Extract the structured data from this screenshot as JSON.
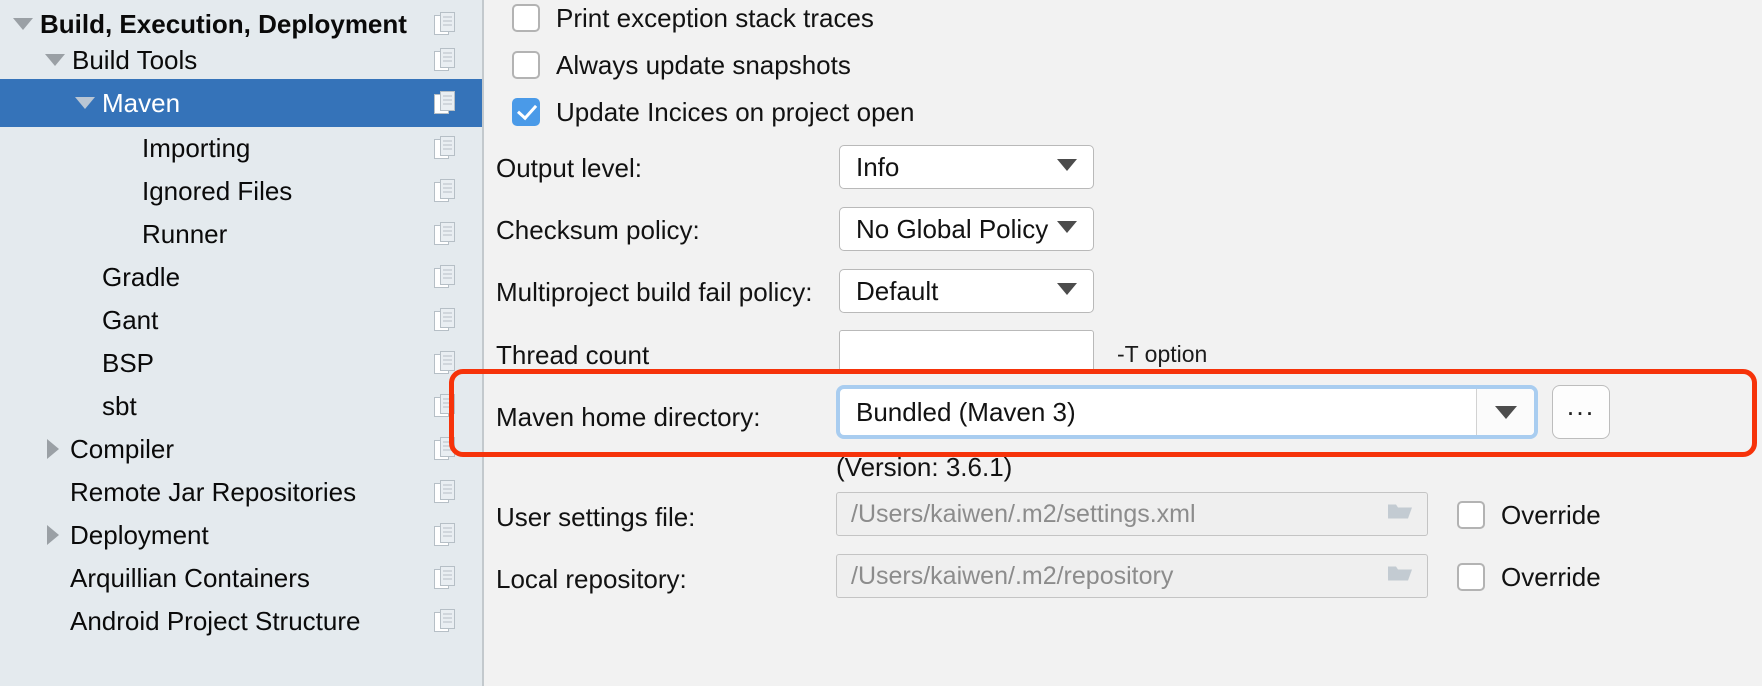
{
  "sidebar": {
    "items": [
      {
        "label": "Build, Execution, Deployment",
        "indent": 8,
        "twisty": "down",
        "bold": true,
        "selected": false
      },
      {
        "label": "Build Tools",
        "indent": 40,
        "twisty": "down",
        "bold": false,
        "selected": false
      },
      {
        "label": "Maven",
        "indent": 72,
        "twisty": "down",
        "bold": false,
        "selected": true
      },
      {
        "label": "Importing",
        "indent": 110,
        "twisty": "none",
        "bold": false,
        "selected": false
      },
      {
        "label": "Ignored Files",
        "indent": 110,
        "twisty": "none",
        "bold": false,
        "selected": false
      },
      {
        "label": "Runner",
        "indent": 110,
        "twisty": "none",
        "bold": false,
        "selected": false
      },
      {
        "label": "Gradle",
        "indent": 72,
        "twisty": "none",
        "bold": false,
        "selected": false
      },
      {
        "label": "Gant",
        "indent": 72,
        "twisty": "none",
        "bold": false,
        "selected": false
      },
      {
        "label": "BSP",
        "indent": 72,
        "twisty": "none",
        "bold": false,
        "selected": false
      },
      {
        "label": "sbt",
        "indent": 72,
        "twisty": "none",
        "bold": false,
        "selected": false
      },
      {
        "label": "Compiler",
        "indent": 40,
        "twisty": "right",
        "bold": false,
        "selected": false
      },
      {
        "label": "Remote Jar Repositories",
        "indent": 40,
        "twisty": "none",
        "bold": false,
        "selected": false
      },
      {
        "label": "Deployment",
        "indent": 40,
        "twisty": "right",
        "bold": false,
        "selected": false
      },
      {
        "label": "Arquillian Containers",
        "indent": 40,
        "twisty": "none",
        "bold": false,
        "selected": false
      },
      {
        "label": "Android Project Structure",
        "indent": 40,
        "twisty": "none",
        "bold": false,
        "selected": false
      }
    ],
    "copy_icon": "copy-icon",
    "selected_color": "#3573b9",
    "background_color": "#e4eaee"
  },
  "settings": {
    "checkboxes": [
      {
        "label": "Print exception stack traces",
        "checked": false
      },
      {
        "label": "Always update snapshots",
        "checked": false
      },
      {
        "label": "Update Incices on project open",
        "checked": true
      }
    ],
    "output_level": {
      "label": "Output level:",
      "value": "Info"
    },
    "checksum_policy": {
      "label": "Checksum policy:",
      "value": "No Global Policy"
    },
    "multiproject_policy": {
      "label": "Multiproject build fail policy:",
      "value": "Default"
    },
    "thread_count": {
      "label": "Thread count",
      "value": "",
      "hint": "-T option"
    },
    "maven_home": {
      "label": "Maven home directory:",
      "value": "Bundled (Maven 3)",
      "browse_label": "...",
      "version_text": "(Version: 3.6.1)"
    },
    "user_settings": {
      "label": "User settings file:",
      "value": "/Users/kaiwen/.m2/settings.xml",
      "override_label": "Override",
      "override_checked": false
    },
    "local_repository": {
      "label": "Local repository:",
      "value": "/Users/kaiwen/.m2/repository",
      "override_label": "Override",
      "override_checked": false
    },
    "annotation_color": "#f6330a",
    "focus_ring_color": "#a9cdf0"
  }
}
